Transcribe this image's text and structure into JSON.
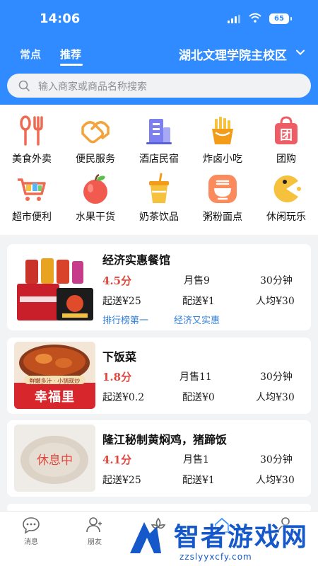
{
  "status_bar": {
    "time": "14:06",
    "battery": "65"
  },
  "header": {
    "tabs": [
      {
        "label": "常点"
      },
      {
        "label": "推荐"
      }
    ],
    "campus": "湖北文理学院主校区"
  },
  "search": {
    "placeholder": "输入商家或商品名称搜索"
  },
  "categories": [
    {
      "label": "美食外卖",
      "icon": "fork-spoon-icon"
    },
    {
      "label": "便民服务",
      "icon": "handshake-icon"
    },
    {
      "label": "酒店民宿",
      "icon": "hotel-icon"
    },
    {
      "label": "炸卤小吃",
      "icon": "fries-icon"
    },
    {
      "label": "团购",
      "icon": "group-buy-bag-icon"
    },
    {
      "label": "超市便利",
      "icon": "shopping-cart-icon"
    },
    {
      "label": "水果干货",
      "icon": "apple-icon"
    },
    {
      "label": "奶茶饮品",
      "icon": "milk-tea-icon"
    },
    {
      "label": "粥粉面点",
      "icon": "noodle-bowl-icon"
    },
    {
      "label": "休闲玩乐",
      "icon": "pacman-icon"
    }
  ],
  "stores": [
    {
      "name": "经济实惠餐馆",
      "score": "4.5分",
      "monthly_sales": "月售9",
      "delivery_time": "30分钟",
      "min_order": "起送¥25",
      "delivery_fee": "配送¥1",
      "per_capita": "人均¥30",
      "tags": [
        "排行榜第一",
        "经济又实惠"
      ]
    },
    {
      "name": "下饭菜",
      "score": "1.8分",
      "monthly_sales": "月售11",
      "delivery_time": "30分钟",
      "min_order": "起送¥0.2",
      "delivery_fee": "配送¥0",
      "per_capita": "人均¥30",
      "thumb_text": {
        "top": "鲜嫩多汁 · 小锅现炒",
        "brand": "幸福里"
      }
    },
    {
      "name": "隆江秘制黄焖鸡，猪蹄饭",
      "score": "4.1分",
      "monthly_sales": "月售1",
      "delivery_time": "30分钟",
      "min_order": "起送¥25",
      "delivery_fee": "配送¥1",
      "per_capita": "人均¥30",
      "closed_label": "休息中"
    }
  ],
  "tabbar": [
    {
      "label": "消息"
    },
    {
      "label": "朋友"
    }
  ],
  "watermark": {
    "title": "智者游戏网",
    "url": "zzslyyxcfy.com"
  },
  "colors": {
    "primary": "#2f8bff",
    "score": "#e0483e",
    "tag": "#2f7fd8"
  }
}
